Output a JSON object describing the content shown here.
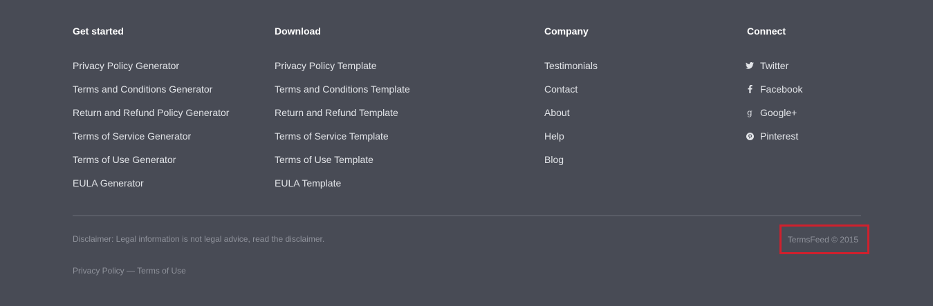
{
  "columns": {
    "get_started": {
      "heading": "Get started",
      "links": [
        "Privacy Policy Generator",
        "Terms and Conditions Generator",
        "Return and Refund Policy Generator",
        "Terms of Service Generator",
        "Terms of Use Generator",
        "EULA Generator"
      ]
    },
    "download": {
      "heading": "Download",
      "links": [
        "Privacy Policy Template",
        "Terms and Conditions Template",
        "Return and Refund Template",
        "Terms of Service Template",
        "Terms of Use Template",
        "EULA Template"
      ]
    },
    "company": {
      "heading": "Company",
      "links": [
        "Testimonials",
        "Contact",
        "About",
        "Help",
        "Blog"
      ]
    },
    "connect": {
      "heading": "Connect",
      "links": [
        {
          "label": "Twitter",
          "icon": "twitter-icon"
        },
        {
          "label": "Facebook",
          "icon": "facebook-icon"
        },
        {
          "label": "Google+",
          "icon": "google-plus-icon"
        },
        {
          "label": "Pinterest",
          "icon": "pinterest-icon"
        }
      ]
    }
  },
  "footer": {
    "disclaimer": "Disclaimer: Legal information is not legal advice, read the disclaimer.",
    "privacy_policy": "Privacy Policy",
    "separator": "—",
    "terms_of_use": "Terms of Use",
    "copyright": "TermsFeed © 2015",
    "highlight_color": "#d0202d"
  }
}
